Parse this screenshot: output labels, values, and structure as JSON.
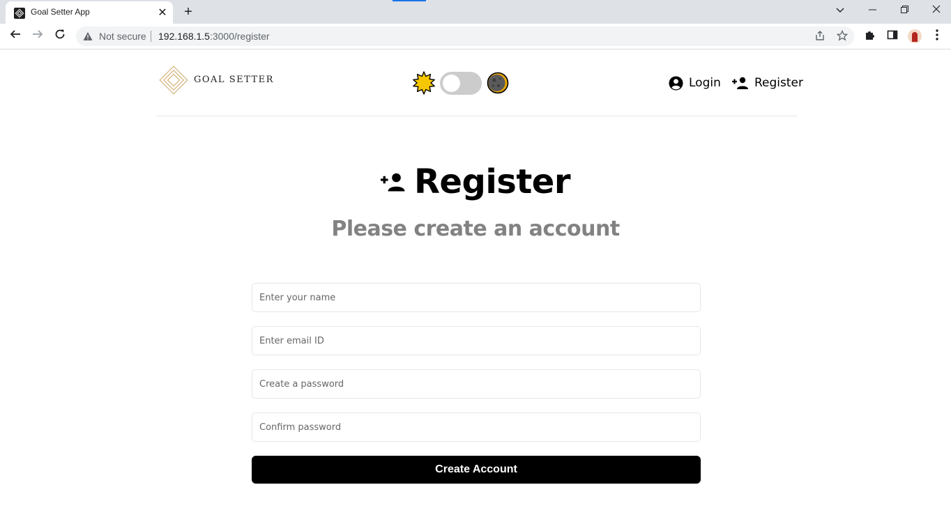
{
  "browser": {
    "tab_title": "Goal Setter App",
    "tab_close": "✕",
    "new_tab": "+",
    "security_label": "Not secure",
    "url_host": "192.168.1.5",
    "url_path": ":3000/register"
  },
  "header": {
    "logo_text": "GOAL SETTER",
    "nav": {
      "login": "Login",
      "register": "Register"
    },
    "theme_toggle": {
      "is_dark": false
    }
  },
  "main": {
    "title": "Register",
    "subtitle": "Please create an account",
    "form": {
      "name_placeholder": "Enter your name",
      "email_placeholder": "Enter email ID",
      "password_placeholder": "Create a password",
      "confirm_placeholder": "Confirm password",
      "submit_label": "Create Account"
    }
  },
  "colors": {
    "logo_gold": "#d4b27a",
    "subtitle_gray": "#828282",
    "button_bg": "#000000"
  }
}
